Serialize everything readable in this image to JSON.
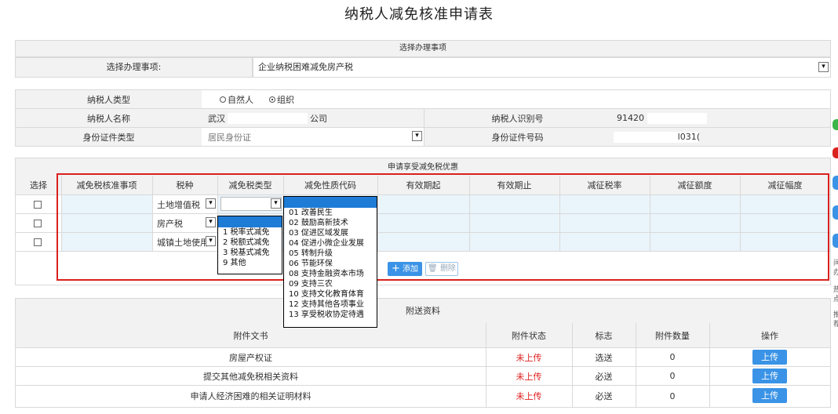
{
  "page_title": "纳税人减免核准申请表",
  "section_select": {
    "header": "选择办理事项",
    "label": "选择办理事项:",
    "value": "企业纳税困难减免房产税"
  },
  "taxpayer": {
    "type_label": "纳税人类型",
    "type_options": [
      "自然人",
      "组织"
    ],
    "type_selected": "组织",
    "name_label": "纳税人名称",
    "name_value_prefix": "武汉",
    "name_value_suffix": "公司",
    "id_label": "纳税人识别号",
    "id_value": "91420",
    "cert_type_label": "身份证件类型",
    "cert_type_value": "居民身份证",
    "cert_no_label": "身份证件号码",
    "cert_no_value": "l031("
  },
  "relief": {
    "header": "申请享受减免税优惠",
    "columns": [
      "选择",
      "减免税核准事项",
      "税种",
      "减免税类型",
      "减免性质代码",
      "有效期起",
      "有效期止",
      "减征税率",
      "减征额度",
      "减征幅度"
    ],
    "rows": [
      {
        "tax": "土地增值税"
      },
      {
        "tax": "房产税"
      },
      {
        "tax": "城镇土地使用"
      }
    ],
    "add_label": "添加",
    "delete_label": "删除"
  },
  "relief_type_dropdown": {
    "options": [
      "1 税率式减免",
      "2 税额式减免",
      "3 税基式减免",
      "9 其他"
    ]
  },
  "nature_code_dropdown": {
    "options": [
      "01 改善民生",
      "02 鼓励高新技术",
      "03 促进区域发展",
      "04 促进小微企业发展",
      "05 转制升级",
      "06 节能环保",
      "08 支持金融资本市场",
      "09 支持三农",
      "10 支持文化教育体育",
      "12 支持其他各项事业",
      "13 享受税收协定待遇"
    ]
  },
  "attachments": {
    "header": "附送资料",
    "columns": [
      "附件文书",
      "附件状态",
      "标志",
      "附件数量",
      "操作"
    ],
    "rows": [
      {
        "name": "房屋产权证",
        "status": "未上传",
        "flag": "选送",
        "count": "0",
        "action": "上传"
      },
      {
        "name": "提交其他减免税相关资料",
        "status": "未上传",
        "flag": "必送",
        "count": "0",
        "action": "上传"
      },
      {
        "name": "申请人经济困难的相关证明材料",
        "status": "未上传",
        "flag": "必送",
        "count": "0",
        "action": "上传"
      }
    ]
  },
  "side_hints": [
    "问",
    "办",
    "热",
    "点",
    "推",
    "荐"
  ],
  "colors": {
    "highlight_border": "#d9211e",
    "upload_button": "#3a93e6",
    "dropdown_selected": "#1e7cd6",
    "status_red": "#e02020"
  }
}
